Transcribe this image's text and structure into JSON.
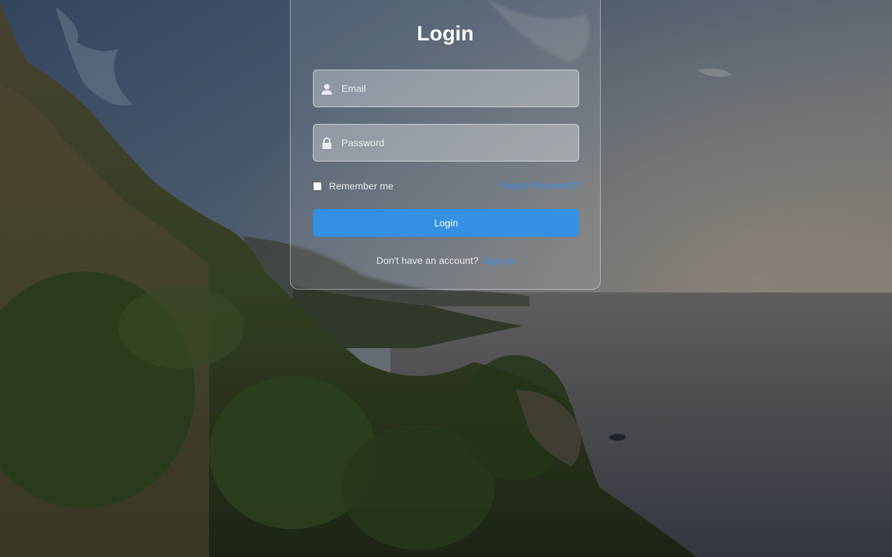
{
  "login": {
    "title": "Login",
    "email_placeholder": "Email",
    "password_placeholder": "Password",
    "remember_label": "Remember me",
    "forgot_label": "Forgot Password?",
    "button_label": "Login",
    "no_account_text": "Don't have an account?",
    "signup_label": "Sign up"
  },
  "icons": {
    "email": "user-icon",
    "password": "lock-icon"
  },
  "colors": {
    "accent": "#3490e3",
    "link": "#3a8fe6"
  }
}
